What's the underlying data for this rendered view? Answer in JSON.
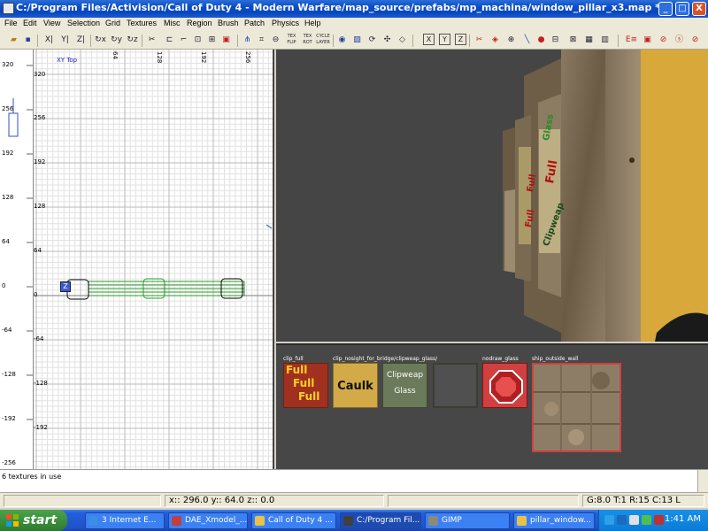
{
  "window": {
    "title": "C:/Program Files/Activision/Call of Duty 4 - Modern Warfare/map_source/prefabs/mp_machina/window_pillar_x3.map *",
    "minimize": "_",
    "maximize": "□",
    "close": "X"
  },
  "menu": [
    "File",
    "Edit",
    "View",
    "Selection",
    "Grid",
    "Textures",
    "Misc",
    "Region",
    "Brush",
    "Patch",
    "Physics",
    "Help"
  ],
  "toolbar": {
    "icons": [
      "open-icon",
      "save-icon",
      "flip-x-icon",
      "flip-y-icon",
      "flip-z-icon",
      "rotate-x-icon",
      "rotate-y-icon",
      "rotate-z-icon",
      "clipper-icon",
      "brush-select-icon",
      "crop-icon",
      "selection-icon",
      "grid-icon",
      "csg-subtract-icon",
      "csg-merge-icon",
      "vertex-icon",
      "texture-lock-icon",
      "texture-lock-rotate-icon",
      "texture-cycle-icon",
      "camera-icon",
      "view-icon",
      "view-side-icon",
      "x-axis-icon",
      "y-axis-icon",
      "z-axis-icon",
      "cubic-clip-icon",
      "light-icon",
      "patch-icon",
      "entity-icon",
      "model-icon",
      "filter-icon",
      "region-icon",
      "help-icon"
    ],
    "tex_lock_1": "TEX FLIP",
    "tex_lock_2": "TEX ROT",
    "cycle_layer": "CYCLE LAYER",
    "axis_x": "X",
    "axis_y": "Y",
    "axis_z": "Z"
  },
  "grid_view": {
    "title": "XY Top",
    "vertical_labels": [
      "320",
      "256",
      "192",
      "128",
      "64",
      "0",
      "-64",
      "-128",
      "-192"
    ],
    "horizontal_labels": [
      "64",
      "128",
      "192",
      "256"
    ],
    "ruler_labels": [
      "320",
      "256",
      "192",
      "128",
      "64",
      "0",
      "-64",
      "-128",
      "-192",
      "-256"
    ],
    "z_marker": "Z"
  },
  "texture_browser": {
    "textures": [
      {
        "name": "clip_full",
        "line1": "Full",
        "line2": "Full",
        "line3": "Full"
      },
      {
        "name": "clip_nosight_for_bridge",
        "line1": "Caulk"
      },
      {
        "name": "clipweap_glass",
        "line1": "Clipweap",
        "line2": "Glass"
      },
      {
        "name": "detail_gridpoint",
        "line1": ""
      },
      {
        "name": "nodraw_glass",
        "line1": ""
      },
      {
        "name": "ship_outside_wall",
        "line1": ""
      }
    ],
    "overlap_label": "clip_nosight_for_bridge/clipweap_glass/detail_gridpoint"
  },
  "camera_view": {
    "wall_labels": [
      "Glass",
      "Full",
      "Full",
      "Clipweap",
      "Full"
    ]
  },
  "console": {
    "text": "6 textures in use"
  },
  "status": {
    "coords": "x:: 296.0  y:: 64.0  z:: 0.0",
    "grid": "G:8.0 T:1 R:15 C:13 L"
  },
  "taskbar": {
    "start": "start",
    "tasks": [
      {
        "label": "3 Internet E...",
        "color": "#3a8ee6"
      },
      {
        "label": "DAE_Xmodel_...",
        "color": "#c04040"
      },
      {
        "label": "Call of Duty 4 ...",
        "color": "#e9c24a"
      },
      {
        "label": "C:/Program Fil...",
        "color": "#404040"
      },
      {
        "label": "GIMP",
        "color": "#8a8a7a"
      },
      {
        "label": "pillar_window...",
        "color": "#e9c24a"
      }
    ],
    "time": "1:41 AM"
  }
}
